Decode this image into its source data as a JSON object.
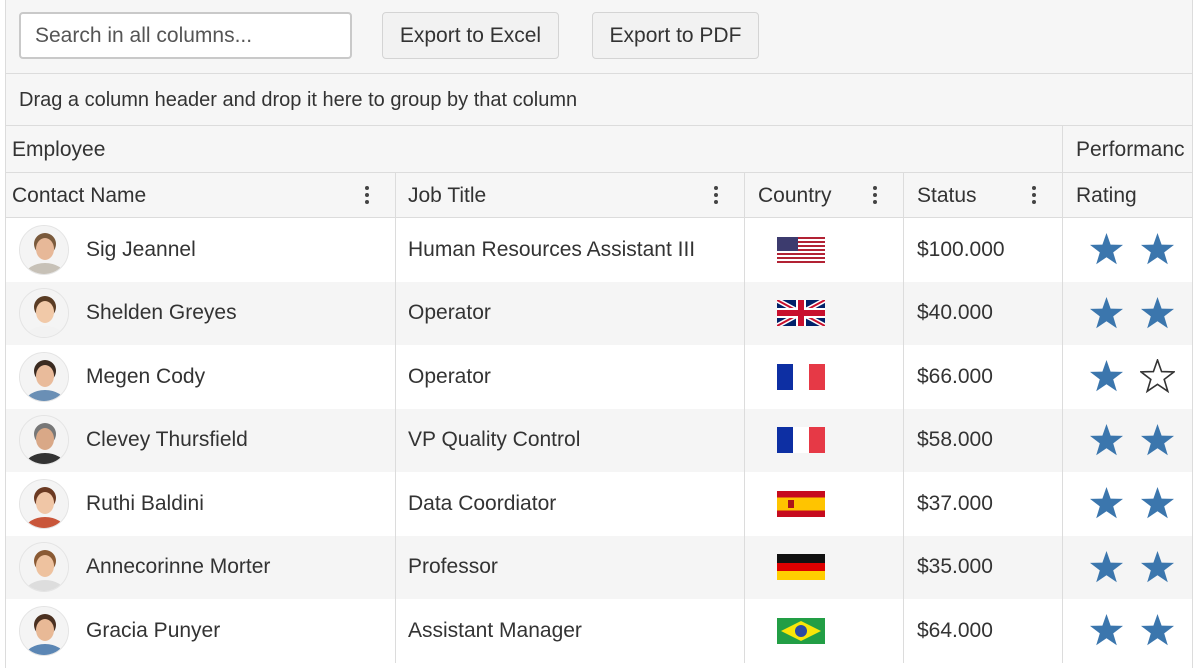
{
  "toolbar": {
    "search_placeholder": "Search in all columns...",
    "export_excel": "Export to Excel",
    "export_pdf": "Export to PDF"
  },
  "group_panel": {
    "hint": "Drag a column header and drop it here to group by that column"
  },
  "column_groups": {
    "employee": "Employee",
    "performance": "Performanc"
  },
  "columns": {
    "contact_name": "Contact Name",
    "job_title": "Job Title",
    "country": "Country",
    "status": "Status",
    "rating": "Rating"
  },
  "colors": {
    "star": "#3b76ad",
    "border": "#dcdcdc",
    "header_bg": "#f6f6f6",
    "alt_row": "#f5f5f5"
  },
  "rows": [
    {
      "name": "Sig Jeannel",
      "job": "Human Resources Assistant III",
      "country_flag": "us-flag-icon",
      "status": "$100.000",
      "stars": [
        true,
        true
      ]
    },
    {
      "name": "Shelden Greyes",
      "job": "Operator",
      "country_flag": "gb-flag-icon",
      "status": "$40.000",
      "stars": [
        true,
        true
      ]
    },
    {
      "name": "Megen Cody",
      "job": "Operator",
      "country_flag": "fr-flag-icon",
      "status": "$66.000",
      "stars": [
        true,
        false
      ]
    },
    {
      "name": "Clevey Thursfield",
      "job": "VP Quality Control",
      "country_flag": "fr-flag-icon",
      "status": "$58.000",
      "stars": [
        true,
        true
      ]
    },
    {
      "name": "Ruthi Baldini",
      "job": "Data Coordiator",
      "country_flag": "es-flag-icon",
      "status": "$37.000",
      "stars": [
        true,
        true
      ]
    },
    {
      "name": "Annecorinne Morter",
      "job": "Professor",
      "country_flag": "de-flag-icon",
      "status": "$35.000",
      "stars": [
        true,
        true
      ]
    },
    {
      "name": "Gracia Punyer",
      "job": "Assistant Manager",
      "country_flag": "br-flag-icon",
      "status": "$64.000",
      "stars": [
        true,
        true
      ]
    }
  ]
}
